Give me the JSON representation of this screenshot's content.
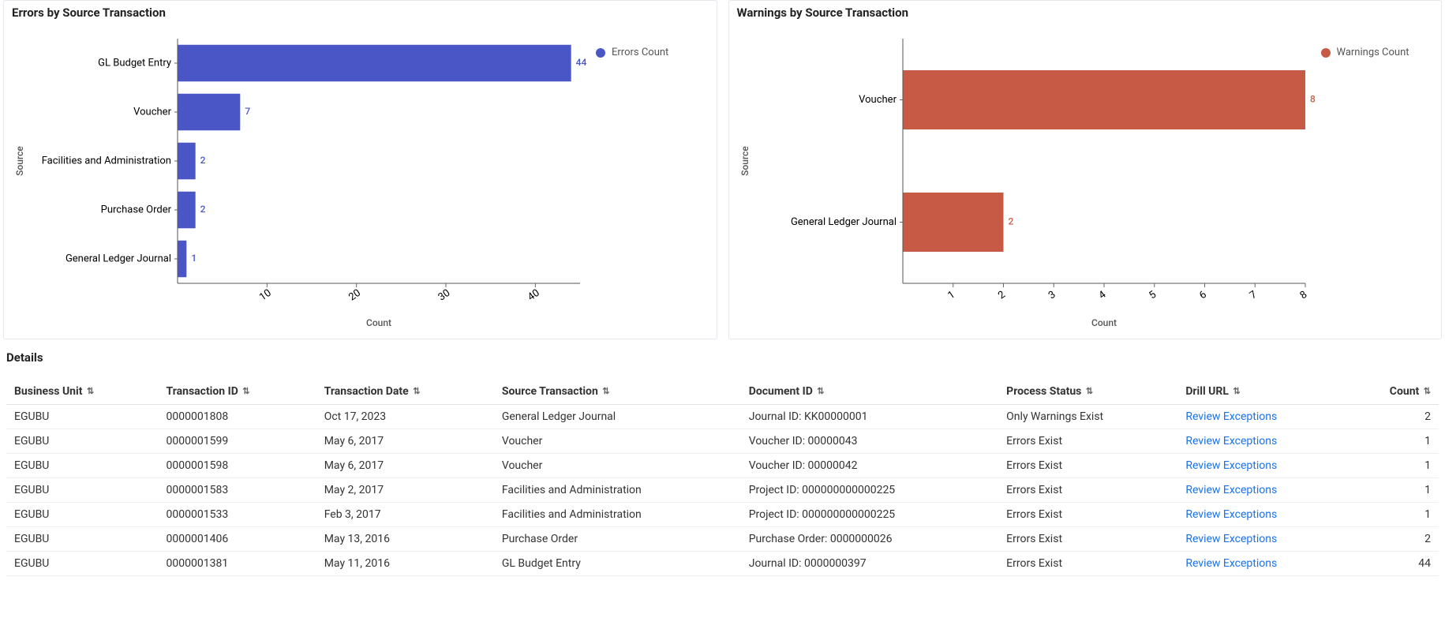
{
  "charts": {
    "errors": {
      "title": "Errors by Source Transaction",
      "legend_label": "Errors Count",
      "color": "#4a56c6",
      "xlabel": "Count",
      "ylabel": "Source"
    },
    "warnings": {
      "title": "Warnings by Source Transaction",
      "legend_label": "Warnings Count",
      "color": "#c75a45",
      "xlabel": "Count",
      "ylabel": "Source"
    }
  },
  "chart_data": [
    {
      "id": "errors",
      "type": "bar",
      "orientation": "horizontal",
      "title": "Errors by Source Transaction",
      "xlabel": "Count",
      "ylabel": "Source",
      "xlim": [
        0,
        45
      ],
      "ticks": [
        10,
        20,
        30,
        40,
        50
      ],
      "categories": [
        "GL Budget Entry",
        "Voucher",
        "Facilities and Administration",
        "Purchase Order",
        "General Ledger Journal"
      ],
      "values": [
        44,
        7,
        2,
        2,
        1
      ],
      "series_name": "Errors Count",
      "color": "#4a56c6"
    },
    {
      "id": "warnings",
      "type": "bar",
      "orientation": "horizontal",
      "title": "Warnings by Source Transaction",
      "xlabel": "Count",
      "ylabel": "Source",
      "xlim": [
        0,
        8
      ],
      "ticks": [
        1,
        2,
        3,
        4,
        5,
        6,
        7,
        8
      ],
      "categories": [
        "Voucher",
        "General Ledger Journal"
      ],
      "values": [
        8,
        2
      ],
      "series_name": "Warnings Count",
      "color": "#c75a45"
    }
  ],
  "details": {
    "title": "Details",
    "link_text": "Review Exceptions",
    "columns": [
      "Business Unit",
      "Transaction ID",
      "Transaction Date",
      "Source Transaction",
      "Document ID",
      "Process Status",
      "Drill URL",
      "Count"
    ],
    "rows": [
      {
        "bu": "EGUBU",
        "tid": "0000001808",
        "date": "Oct 17, 2023",
        "src": "General Ledger Journal",
        "doc": "Journal ID: KK00000001",
        "status": "Only Warnings Exist",
        "count": 2
      },
      {
        "bu": "EGUBU",
        "tid": "0000001599",
        "date": "May 6, 2017",
        "src": "Voucher",
        "doc": "Voucher ID: 00000043",
        "status": "Errors Exist",
        "count": 1
      },
      {
        "bu": "EGUBU",
        "tid": "0000001598",
        "date": "May 6, 2017",
        "src": "Voucher",
        "doc": "Voucher ID: 00000042",
        "status": "Errors Exist",
        "count": 1
      },
      {
        "bu": "EGUBU",
        "tid": "0000001583",
        "date": "May 2, 2017",
        "src": "Facilities and Administration",
        "doc": "Project ID: 000000000000225",
        "status": "Errors Exist",
        "count": 1
      },
      {
        "bu": "EGUBU",
        "tid": "0000001533",
        "date": "Feb 3, 2017",
        "src": "Facilities and Administration",
        "doc": "Project ID: 000000000000225",
        "status": "Errors Exist",
        "count": 1
      },
      {
        "bu": "EGUBU",
        "tid": "0000001406",
        "date": "May 13, 2016",
        "src": "Purchase Order",
        "doc": "Purchase Order: 0000000026",
        "status": "Errors Exist",
        "count": 2
      },
      {
        "bu": "EGUBU",
        "tid": "0000001381",
        "date": "May 11, 2016",
        "src": "GL Budget Entry",
        "doc": "Journal ID: 0000000397",
        "status": "Errors Exist",
        "count": 44
      }
    ]
  }
}
